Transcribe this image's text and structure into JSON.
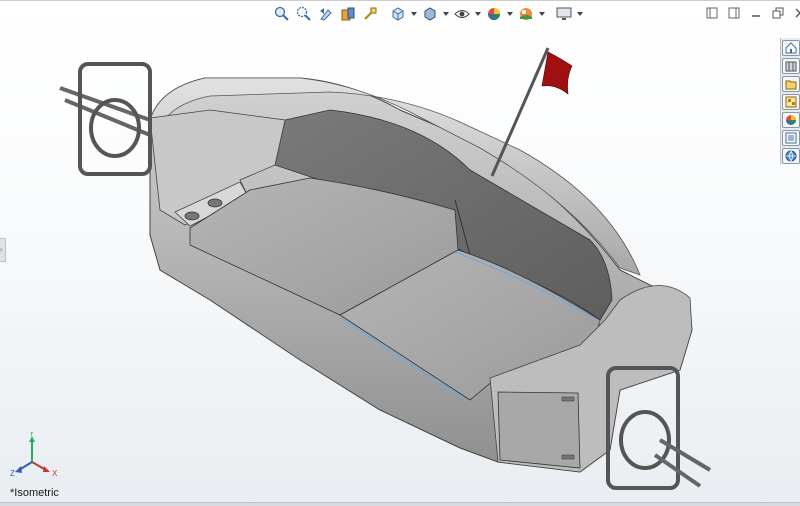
{
  "viewport": {
    "view_orientation_label": "*Isometric",
    "triad_axes": {
      "x": "X",
      "y": "Y",
      "z": "Z"
    }
  },
  "heads_up_toolbar": [
    {
      "name": "zoom-to-fit",
      "icon": "zoom-to-fit-icon"
    },
    {
      "name": "zoom-to-area",
      "icon": "zoom-to-area-icon"
    },
    {
      "name": "previous-view",
      "icon": "previous-view-icon"
    },
    {
      "name": "section-view",
      "icon": "section-view-icon"
    },
    {
      "name": "dynamic-annotation",
      "icon": "annotation-icon"
    },
    {
      "name": "view-orientation",
      "icon": "view-orientation-icon"
    },
    {
      "name": "display-style",
      "icon": "display-style-icon"
    },
    {
      "name": "hide-show-items",
      "icon": "eye-icon"
    },
    {
      "name": "edit-appearance",
      "icon": "appearance-icon"
    },
    {
      "name": "apply-scene",
      "icon": "scene-icon"
    },
    {
      "name": "view-settings",
      "icon": "monitor-icon"
    }
  ],
  "task_pane": [
    {
      "name": "solidworks-resources",
      "icon": "home-icon"
    },
    {
      "name": "design-library",
      "icon": "library-icon"
    },
    {
      "name": "file-explorer",
      "icon": "folder-icon"
    },
    {
      "name": "view-palette",
      "icon": "view-palette-icon"
    },
    {
      "name": "appearances-scenes",
      "icon": "color-wheel-icon"
    },
    {
      "name": "custom-properties",
      "icon": "properties-icon"
    },
    {
      "name": "solidworks-forum",
      "icon": "globe-icon"
    }
  ],
  "colors": {
    "background_top": "#ffffff",
    "background_bottom": "#e9edf1",
    "model_body": "#b9b9b9",
    "model_dark": "#6e6e6e",
    "seat": "#a6a6a6",
    "flag": "#a01010",
    "axis_x": "#c0392b",
    "axis_y": "#27ae60",
    "axis_z": "#2c5fb3",
    "edge_highlight": "#6fa8dc"
  }
}
